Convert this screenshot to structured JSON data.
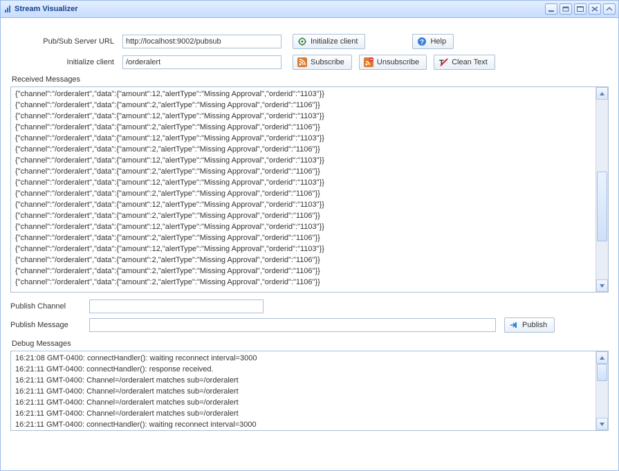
{
  "window": {
    "title": "Stream Visualizer"
  },
  "form": {
    "server_url": {
      "label": "Pub/Sub Server URL",
      "value": "http://localhost:9002/pubsub"
    },
    "init_client": {
      "label": "Initialize client",
      "value": "/orderalert"
    },
    "publish_channel": {
      "label": "Publish Channel",
      "value": ""
    },
    "publish_message": {
      "label": "Publish Message",
      "value": ""
    }
  },
  "buttons": {
    "initialize": "Initialize client",
    "help": "Help",
    "subscribe": "Subscribe",
    "unsubscribe": "Unsubscribe",
    "clean_text": "Clean Text",
    "publish": "Publish"
  },
  "sections": {
    "received": "Received Messages",
    "debug": "Debug Messages"
  },
  "received_messages": [
    "{\"channel\":\"/orderalert\",\"data\":{\"amount\":12,\"alertType\":\"Missing Approval\",\"orderid\":\"1103\"}}",
    "{\"channel\":\"/orderalert\",\"data\":{\"amount\":2,\"alertType\":\"Missing Approval\",\"orderid\":\"1106\"}}",
    "{\"channel\":\"/orderalert\",\"data\":{\"amount\":12,\"alertType\":\"Missing Approval\",\"orderid\":\"1103\"}}",
    "{\"channel\":\"/orderalert\",\"data\":{\"amount\":2,\"alertType\":\"Missing Approval\",\"orderid\":\"1106\"}}",
    "{\"channel\":\"/orderalert\",\"data\":{\"amount\":12,\"alertType\":\"Missing Approval\",\"orderid\":\"1103\"}}",
    "{\"channel\":\"/orderalert\",\"data\":{\"amount\":2,\"alertType\":\"Missing Approval\",\"orderid\":\"1106\"}}",
    "{\"channel\":\"/orderalert\",\"data\":{\"amount\":12,\"alertType\":\"Missing Approval\",\"orderid\":\"1103\"}}",
    "{\"channel\":\"/orderalert\",\"data\":{\"amount\":2,\"alertType\":\"Missing Approval\",\"orderid\":\"1106\"}}",
    "{\"channel\":\"/orderalert\",\"data\":{\"amount\":12,\"alertType\":\"Missing Approval\",\"orderid\":\"1103\"}}",
    "{\"channel\":\"/orderalert\",\"data\":{\"amount\":2,\"alertType\":\"Missing Approval\",\"orderid\":\"1106\"}}",
    "{\"channel\":\"/orderalert\",\"data\":{\"amount\":12,\"alertType\":\"Missing Approval\",\"orderid\":\"1103\"}}",
    "{\"channel\":\"/orderalert\",\"data\":{\"amount\":2,\"alertType\":\"Missing Approval\",\"orderid\":\"1106\"}}",
    "{\"channel\":\"/orderalert\",\"data\":{\"amount\":12,\"alertType\":\"Missing Approval\",\"orderid\":\"1103\"}}",
    "{\"channel\":\"/orderalert\",\"data\":{\"amount\":2,\"alertType\":\"Missing Approval\",\"orderid\":\"1106\"}}",
    "{\"channel\":\"/orderalert\",\"data\":{\"amount\":12,\"alertType\":\"Missing Approval\",\"orderid\":\"1103\"}}",
    "{\"channel\":\"/orderalert\",\"data\":{\"amount\":2,\"alertType\":\"Missing Approval\",\"orderid\":\"1106\"}}",
    "{\"channel\":\"/orderalert\",\"data\":{\"amount\":2,\"alertType\":\"Missing Approval\",\"orderid\":\"1106\"}}",
    "{\"channel\":\"/orderalert\",\"data\":{\"amount\":2,\"alertType\":\"Missing Approval\",\"orderid\":\"1106\"}}"
  ],
  "debug_messages": [
    "16:21:08 GMT-0400: connectHandler(): waiting reconnect interval=3000",
    "16:21:11 GMT-0400: connectHandler(): response received.",
    "16:21:11 GMT-0400: Channel=/orderalert matches sub=/orderalert",
    "16:21:11 GMT-0400: Channel=/orderalert matches sub=/orderalert",
    "16:21:11 GMT-0400: Channel=/orderalert matches sub=/orderalert",
    "16:21:11 GMT-0400: Channel=/orderalert matches sub=/orderalert",
    "16:21:11 GMT-0400: connectHandler(): waiting reconnect interval=3000"
  ]
}
